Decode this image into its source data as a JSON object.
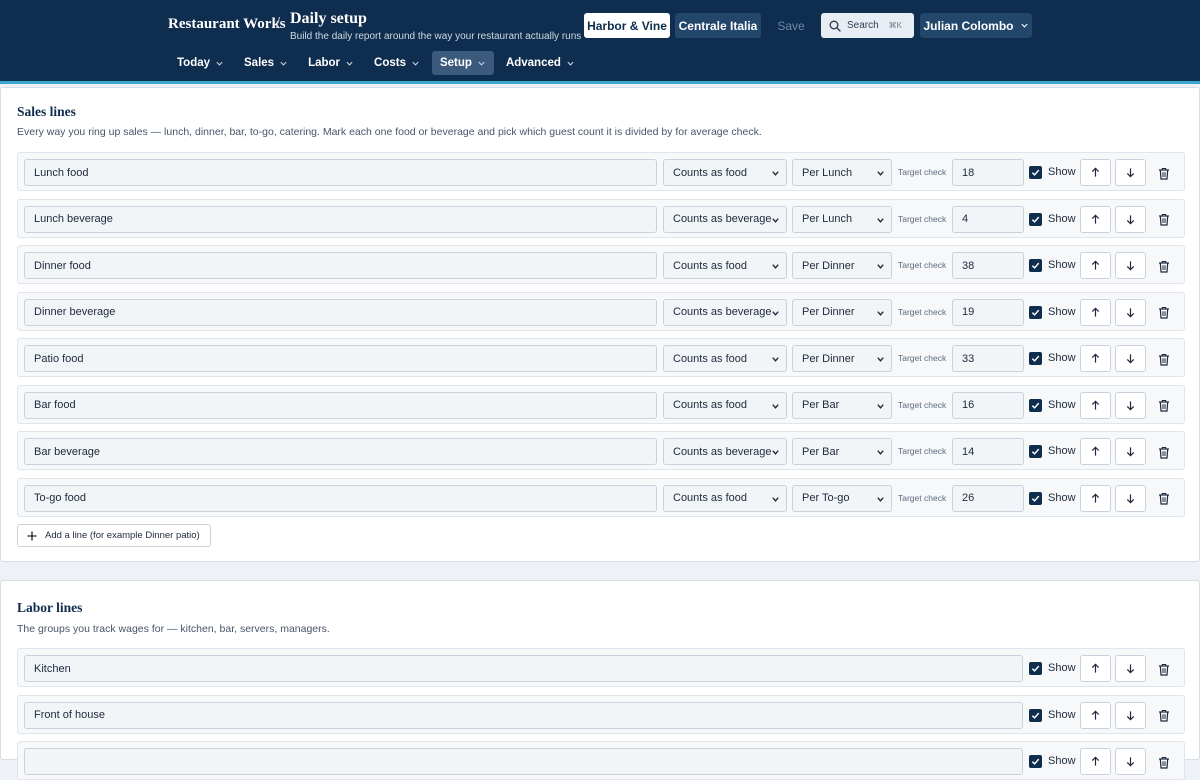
{
  "header": {
    "brand": "Restaurant Works",
    "separator": "/",
    "title": "Daily setup",
    "subtitle": "Build the daily report around the way your restaurant actually runs",
    "locations": [
      "Harbor & Vine",
      "Centrale Italia"
    ],
    "save_label": "Save",
    "search_label": "Search",
    "search_shortcut": "⌘K",
    "user_name": "Julian Colombo"
  },
  "nav": [
    {
      "label": "Today"
    },
    {
      "label": "Sales"
    },
    {
      "label": "Labor"
    },
    {
      "label": "Costs"
    },
    {
      "label": "Setup"
    },
    {
      "label": "Advanced"
    }
  ],
  "sales": {
    "title": "Sales lines",
    "description": "Every way you ring up sales — lunch, dinner, bar, to-go, catering. Mark each one food or beverage and pick which guest count it is divided by for average check.",
    "target_label": "Target check",
    "show_label": "Show",
    "rows": [
      {
        "name": "Lunch food",
        "kind": "Counts as food",
        "per": "Per Lunch",
        "target": "18"
      },
      {
        "name": "Lunch beverage",
        "kind": "Counts as beverage",
        "per": "Per Lunch",
        "target": "4"
      },
      {
        "name": "Dinner food",
        "kind": "Counts as food",
        "per": "Per Dinner",
        "target": "38"
      },
      {
        "name": "Dinner beverage",
        "kind": "Counts as beverage",
        "per": "Per Dinner",
        "target": "19"
      },
      {
        "name": "Patio food",
        "kind": "Counts as food",
        "per": "Per Dinner",
        "target": "33"
      },
      {
        "name": "Bar food",
        "kind": "Counts as food",
        "per": "Per Bar",
        "target": "16"
      },
      {
        "name": "Bar beverage",
        "kind": "Counts as beverage",
        "per": "Per Bar",
        "target": "14"
      },
      {
        "name": "To-go food",
        "kind": "Counts as food",
        "per": "Per To-go",
        "target": "26"
      }
    ],
    "add_label": "Add a line (for example Dinner patio)"
  },
  "labor": {
    "title": "Labor lines",
    "description": "The groups you track wages for — kitchen, bar, servers, managers.",
    "show_label": "Show",
    "rows": [
      {
        "name": "Kitchen"
      },
      {
        "name": "Front of house"
      },
      {
        "name": ""
      }
    ]
  }
}
